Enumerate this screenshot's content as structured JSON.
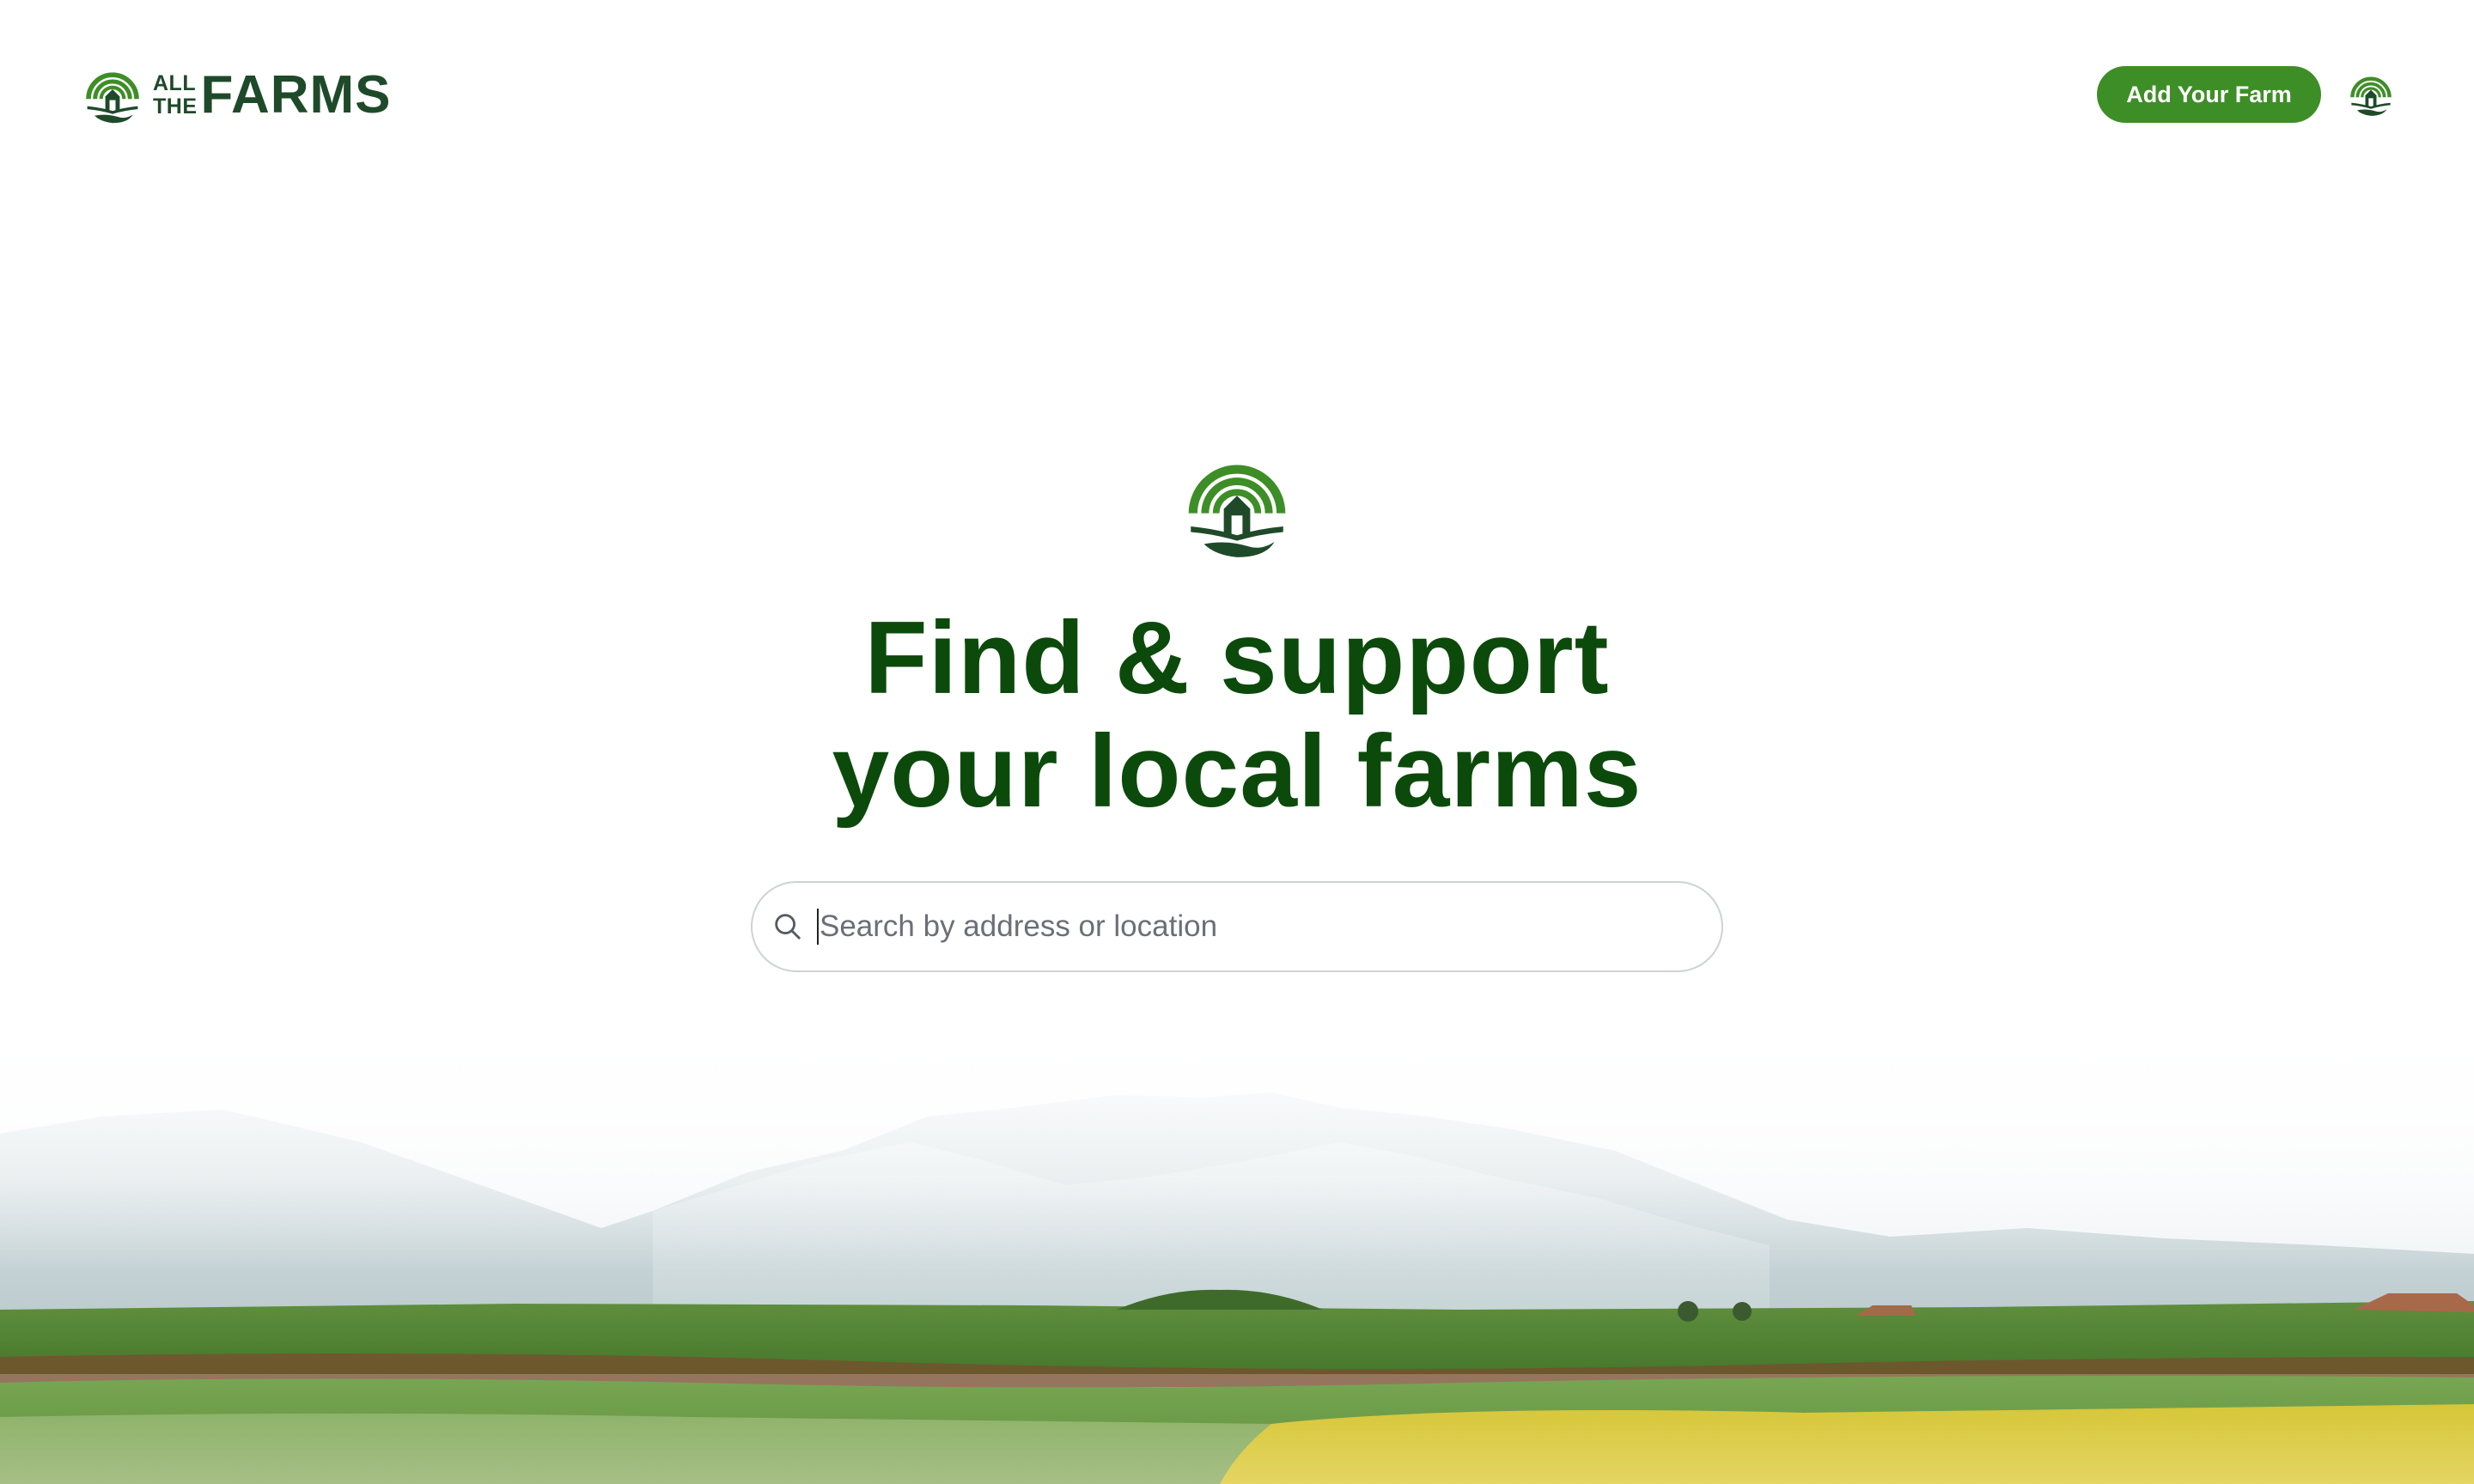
{
  "header": {
    "brand_small_top": "ALL",
    "brand_small_bottom": "THE",
    "brand_big": "FARMS",
    "add_farm_label": "Add Your Farm",
    "account_icon": "farm-logo-icon"
  },
  "hero": {
    "logo_icon": "farm-logo-icon",
    "title_line1": "Find & support",
    "title_line2": "your local farms"
  },
  "search": {
    "icon": "search-icon",
    "placeholder": "Search by address or location",
    "value": ""
  },
  "colors": {
    "brand_dark": "#1f4a2a",
    "brand_green": "#3e8e27",
    "title_green": "#0c4a0c",
    "field_yellow": "#d8c83a"
  }
}
